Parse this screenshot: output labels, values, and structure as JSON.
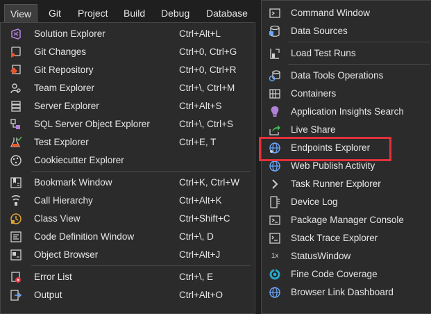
{
  "menubar": {
    "items": [
      "View",
      "Git",
      "Project",
      "Build",
      "Debug",
      "Database"
    ]
  },
  "view_menu": {
    "items": [
      {
        "label": "Solution Explorer",
        "shortcut": "Ctrl+Alt+L",
        "icon": "solution-explorer-icon"
      },
      {
        "label": "Git Changes",
        "shortcut": "Ctrl+0, Ctrl+G",
        "icon": "git-changes-icon"
      },
      {
        "label": "Git Repository",
        "shortcut": "Ctrl+0, Ctrl+R",
        "icon": "git-repository-icon"
      },
      {
        "label": "Team Explorer",
        "shortcut": "Ctrl+\\, Ctrl+M",
        "icon": "team-explorer-icon"
      },
      {
        "label": "Server Explorer",
        "shortcut": "Ctrl+Alt+S",
        "icon": "server-explorer-icon"
      },
      {
        "label": "SQL Server Object Explorer",
        "shortcut": "Ctrl+\\, Ctrl+S",
        "icon": "sql-server-icon"
      },
      {
        "label": "Test Explorer",
        "shortcut": "Ctrl+E, T",
        "icon": "test-explorer-icon"
      },
      {
        "label": "Cookiecutter Explorer",
        "shortcut": "",
        "icon": "cookiecutter-icon"
      },
      {
        "label": "Bookmark Window",
        "shortcut": "Ctrl+K, Ctrl+W",
        "icon": "bookmark-icon"
      },
      {
        "label": "Call Hierarchy",
        "shortcut": "Ctrl+Alt+K",
        "icon": "call-hierarchy-icon"
      },
      {
        "label": "Class View",
        "shortcut": "Ctrl+Shift+C",
        "icon": "class-view-icon"
      },
      {
        "label": "Code Definition Window",
        "shortcut": "Ctrl+\\, D",
        "icon": "code-definition-icon"
      },
      {
        "label": "Object Browser",
        "shortcut": "Ctrl+Alt+J",
        "icon": "object-browser-icon"
      },
      {
        "label": "Error List",
        "shortcut": "Ctrl+\\, E",
        "icon": "error-list-icon"
      },
      {
        "label": "Output",
        "shortcut": "Ctrl+Alt+O",
        "icon": "output-icon"
      }
    ]
  },
  "other_windows_menu": {
    "items": [
      {
        "label": "Command Window",
        "icon": "command-window-icon"
      },
      {
        "label": "Data Sources",
        "icon": "data-sources-icon"
      },
      {
        "label": "Load Test Runs",
        "icon": "load-test-icon"
      },
      {
        "label": "Data Tools Operations",
        "icon": "data-tools-icon"
      },
      {
        "label": "Containers",
        "icon": "containers-icon"
      },
      {
        "label": "Application Insights Search",
        "icon": "app-insights-icon"
      },
      {
        "label": "Live Share",
        "icon": "live-share-icon"
      },
      {
        "label": "Endpoints Explorer",
        "icon": "endpoints-globe-icon"
      },
      {
        "label": "Web Publish Activity",
        "icon": "web-publish-icon"
      },
      {
        "label": "Task Runner Explorer",
        "icon": "task-runner-icon"
      },
      {
        "label": "Device Log",
        "icon": "device-log-icon"
      },
      {
        "label": "Package Manager Console",
        "icon": "package-manager-icon"
      },
      {
        "label": "Stack Trace Explorer",
        "icon": "stack-trace-icon"
      },
      {
        "label": "StatusWindow",
        "icon": "status-window-icon",
        "glyph": "1x"
      },
      {
        "label": "Fine Code Coverage",
        "icon": "code-coverage-icon"
      },
      {
        "label": "Browser Link Dashboard",
        "icon": "browser-link-icon"
      }
    ]
  },
  "colors": {
    "highlight_border": "#e0323b"
  }
}
